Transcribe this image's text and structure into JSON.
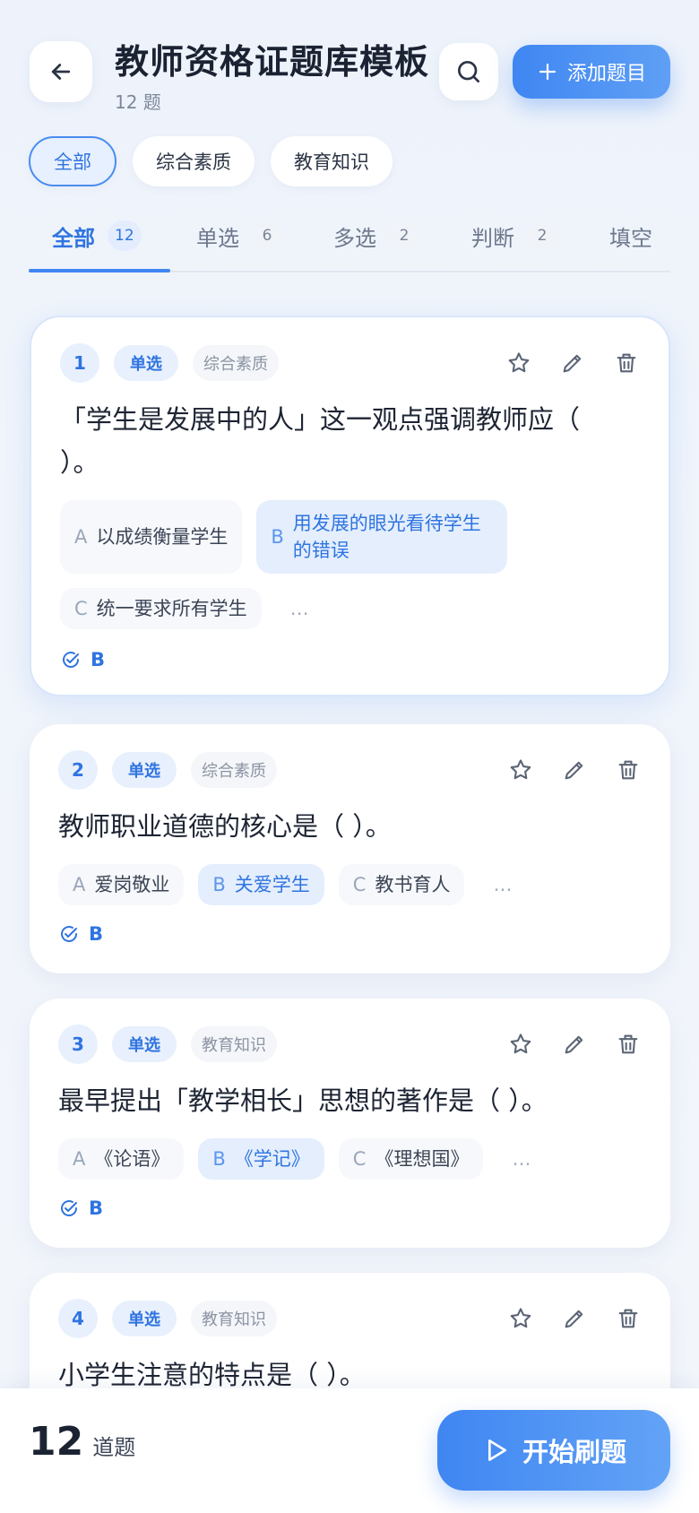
{
  "header": {
    "title": "教师资格证题库模板",
    "subtitle": "12 题",
    "add_label": "添加题目"
  },
  "filters": [
    "全部",
    "综合素质",
    "教育知识"
  ],
  "tabs": [
    {
      "label": "全部",
      "count": "12"
    },
    {
      "label": "单选",
      "count": "6"
    },
    {
      "label": "多选",
      "count": "2"
    },
    {
      "label": "判断",
      "count": "2"
    },
    {
      "label": "填空",
      "count": ""
    }
  ],
  "questions": [
    {
      "num": "1",
      "type": "单选",
      "category": "综合素质",
      "text": "「学生是发展中的人」这一观点强调教师应（ ）。",
      "options": [
        {
          "letter": "A",
          "text": "以成绩衡量学生"
        },
        {
          "letter": "B",
          "text": "用发展的眼光看待学生的错误"
        },
        {
          "letter": "C",
          "text": "统一要求所有学生"
        }
      ],
      "more": "…",
      "answer": "B"
    },
    {
      "num": "2",
      "type": "单选",
      "category": "综合素质",
      "text": "教师职业道德的核心是（ ）。",
      "options": [
        {
          "letter": "A",
          "text": "爱岗敬业"
        },
        {
          "letter": "B",
          "text": "关爱学生"
        },
        {
          "letter": "C",
          "text": "教书育人"
        }
      ],
      "more": "…",
      "answer": "B"
    },
    {
      "num": "3",
      "type": "单选",
      "category": "教育知识",
      "text": "最早提出「教学相长」思想的著作是（ ）。",
      "options": [
        {
          "letter": "A",
          "text": "《论语》"
        },
        {
          "letter": "B",
          "text": "《学记》"
        },
        {
          "letter": "C",
          "text": "《理想国》"
        }
      ],
      "more": "…",
      "answer": "B"
    },
    {
      "num": "4",
      "type": "单选",
      "category": "教育知识",
      "text": "小学生注意的特点是（ ）。"
    }
  ],
  "footer": {
    "count": "12",
    "count_label": "道题",
    "start_label": "开始刷题"
  },
  "colors": {
    "accent": "#3f86f2",
    "accent_dark": "#2f74e0",
    "bg": "#eef3fb"
  }
}
